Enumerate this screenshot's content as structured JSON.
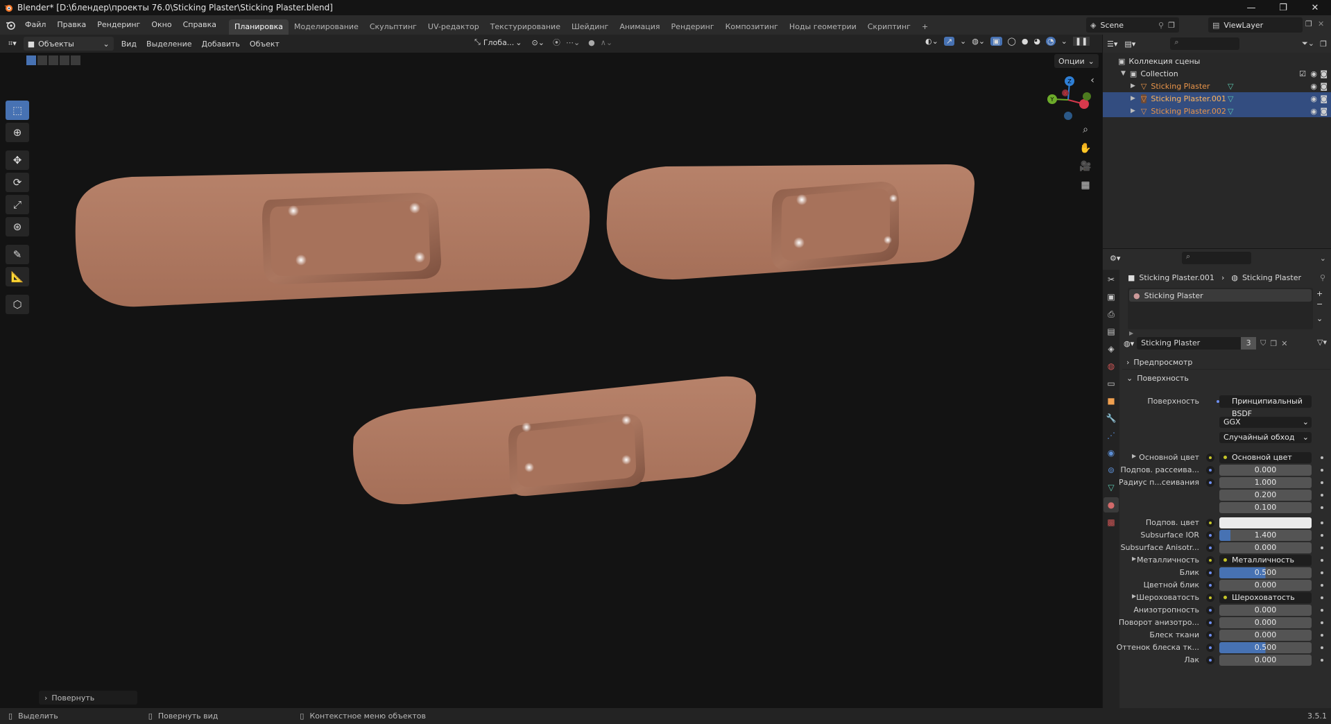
{
  "titlebar": {
    "title": "Blender* [D:\\блендер\\проекты 76.0\\Sticking Plaster\\Sticking Plaster.blend]",
    "minimize": "—",
    "maximize": "❐",
    "close": "✕"
  },
  "menu": [
    "Файл",
    "Правка",
    "Рендеринг",
    "Окно",
    "Справка"
  ],
  "workspaces": [
    "Планировка",
    "Моделирование",
    "Скульптинг",
    "UV-редактор",
    "Текстурирование",
    "Шейдинг",
    "Анимация",
    "Рендеринг",
    "Композитинг",
    "Ноды геометрии",
    "Скриптинг",
    "+"
  ],
  "active_workspace": "Планировка",
  "scene": {
    "label": "Scene",
    "view_layer": "ViewLayer"
  },
  "viewport_header": {
    "mode": "Объекты",
    "menus": [
      "Вид",
      "Выделение",
      "Добавить",
      "Объект"
    ],
    "transform_orientation": "Глоба...",
    "options": "Опции"
  },
  "viewport": {
    "redo_panel": "Повернуть"
  },
  "outliner": {
    "scene_collection": "Коллекция сцены",
    "collection": "Collection",
    "objects": [
      {
        "name": "Sticking Plaster",
        "selected": false
      },
      {
        "name": "Sticking Plaster.001",
        "selected": true
      },
      {
        "name": "Sticking Plaster.002",
        "selected": true
      }
    ]
  },
  "properties": {
    "breadcrumb_object": "Sticking Plaster.001",
    "breadcrumb_material": "Sticking Plaster",
    "material_slot": "Sticking Plaster",
    "material_name": "Sticking Plaster",
    "material_users": "3",
    "panel_preview": "Предпросмотр",
    "panel_surface": "Поверхность",
    "surface_label": "Поверхность",
    "surface_value": "Принципиальный BSDF",
    "distribution": "GGX",
    "subsurface_method": "Случайный обход",
    "rows": [
      {
        "label": "Основной цвет",
        "value": "Основной цвет",
        "kind": "link",
        "expand": true
      },
      {
        "label": "Подпов. рассеива...",
        "value": "0.000",
        "kind": "num"
      },
      {
        "label": "Радиус п...сеивания",
        "value": "1.000",
        "kind": "num"
      },
      {
        "label": "",
        "value": "0.200",
        "kind": "num"
      },
      {
        "label": "",
        "value": "0.100",
        "kind": "num"
      },
      {
        "label": "Подпов. цвет",
        "value": "",
        "kind": "color"
      },
      {
        "label": "Subsurface IOR",
        "value": "1.400",
        "kind": "ior"
      },
      {
        "label": "Subsurface Anisotr...",
        "value": "0.000",
        "kind": "num"
      },
      {
        "label": "Металличность",
        "value": "Металличность",
        "kind": "link",
        "expand": true
      },
      {
        "label": "Блик",
        "value": "0.500",
        "kind": "slider"
      },
      {
        "label": "Цветной блик",
        "value": "0.000",
        "kind": "num"
      },
      {
        "label": "Шероховатость",
        "value": "Шероховатость",
        "kind": "link",
        "expand": true
      },
      {
        "label": "Анизотропность",
        "value": "0.000",
        "kind": "num"
      },
      {
        "label": "Поворот анизотро...",
        "value": "0.000",
        "kind": "num"
      },
      {
        "label": "Блеск ткани",
        "value": "0.000",
        "kind": "num"
      },
      {
        "label": "Оттенок блеска тк...",
        "value": "0.500",
        "kind": "slider"
      },
      {
        "label": "Лак",
        "value": "0.000",
        "kind": "num"
      }
    ]
  },
  "statusbar": {
    "select": "Выделить",
    "rotate_view": "Повернуть вид",
    "context_menu": "Контекстное меню объектов",
    "version": "3.5.1"
  },
  "colors": {
    "accent": "#4772b3",
    "selection": "#334d80",
    "plaster": "#b07c65",
    "object_name": "#e8944a"
  }
}
